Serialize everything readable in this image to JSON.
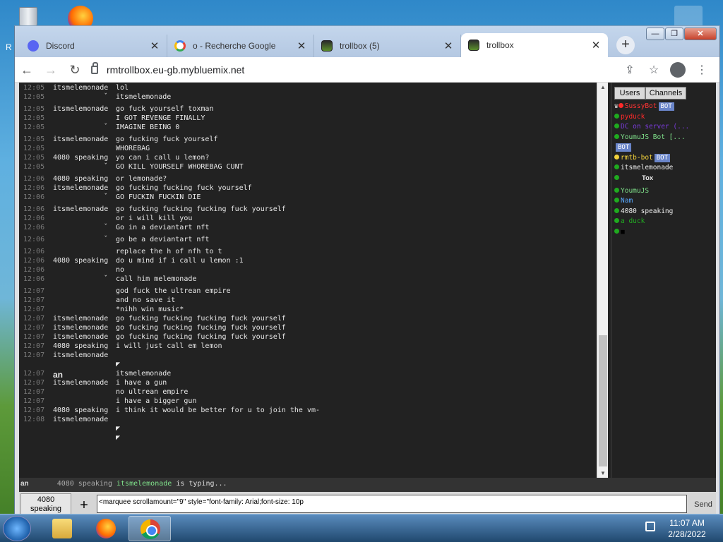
{
  "desktop": {
    "left_label": "R"
  },
  "browser": {
    "tabs": [
      {
        "title": "Discord",
        "favicon": "discord-icon"
      },
      {
        "title": "o - Recherche Google",
        "favicon": "google-icon"
      },
      {
        "title": "trollbox (5)",
        "favicon": "trollbox-icon"
      },
      {
        "title": "trollbox",
        "favicon": "trollbox-icon",
        "active": true
      }
    ],
    "url": "rmtrollbox.eu-gb.mybluemix.net"
  },
  "chat": {
    "messages": [
      {
        "time": "12:05",
        "nick": "itsmelemonade",
        "text": "lol"
      },
      {
        "time": "12:05",
        "nick": "",
        "text": "itsmelemonade",
        "quote": true
      },
      {
        "time": "12:05",
        "nick": "itsmelemonade",
        "text": "go fuck yourself toxman"
      },
      {
        "time": "12:05",
        "nick": "",
        "text": "I GOT REVENGE FINALLY"
      },
      {
        "time": "12:05",
        "nick": "",
        "text": "IMAGINE BEING 0",
        "quote": true
      },
      {
        "time": "12:05",
        "nick": "itsmelemonade",
        "text": "go fucking fuck yourself"
      },
      {
        "time": "12:05",
        "nick": "",
        "text": "WHOREBAG"
      },
      {
        "time": "12:05",
        "nick": "4080 speaking",
        "text": "yo can i call u lemon?"
      },
      {
        "time": "12:05",
        "nick": "",
        "text": "GO KILL YOURSELF WHOREBAG CUNT",
        "quote": true
      },
      {
        "time": "12:06",
        "nick": "4080 speaking",
        "text": "or lemonade?"
      },
      {
        "time": "12:06",
        "nick": "itsmelemonade",
        "text": "go fucking fucking fuck yourself"
      },
      {
        "time": "12:06",
        "nick": "",
        "text": "GO FUCKIN FUCKIN DIE",
        "quote": true
      },
      {
        "time": "12:06",
        "nick": "itsmelemonade",
        "text": "go fucking fucking fucking fuck yourself"
      },
      {
        "time": "12:06",
        "nick": "",
        "text": "or i will kill you"
      },
      {
        "time": "12:06",
        "nick": "",
        "text": "Go in a deviantart nft",
        "quote": true
      },
      {
        "time": "12:06",
        "nick": "",
        "text": "go be a deviantart nft",
        "quote": true
      },
      {
        "time": "12:06",
        "nick": "",
        "text": "replace the h of nfh to t"
      },
      {
        "time": "12:06",
        "nick": "4080 speaking",
        "text": "do u mind if i call u lemon :1"
      },
      {
        "time": "12:06",
        "nick": "",
        "text": "no"
      },
      {
        "time": "12:06",
        "nick": "",
        "text": "call him melemonade",
        "quote": true
      },
      {
        "time": "12:07",
        "nick": "",
        "text": "god fuck the ultrean empire"
      },
      {
        "time": "12:07",
        "nick": "",
        "text": "and no save it"
      },
      {
        "time": "12:07",
        "nick": "",
        "text": "*nihh win music*"
      },
      {
        "time": "12:07",
        "nick": "itsmelemonade",
        "text": "go fucking fucking fucking fuck yourself"
      },
      {
        "time": "12:07",
        "nick": "itsmelemonade",
        "text": "go fucking fucking fucking fuck yourself"
      },
      {
        "time": "12:07",
        "nick": "itsmelemonade",
        "text": "go fucking fucking fucking fuck yourself"
      },
      {
        "time": "12:07",
        "nick": "4080 speaking",
        "text": "i will just call em lemon"
      },
      {
        "time": "12:07",
        "nick": "itsmelemonade",
        "text": ""
      },
      {
        "time": "",
        "nick": "",
        "text": "◤"
      },
      {
        "time": "12:07",
        "nick": "an",
        "text": "itsmelemonade",
        "bignick": true
      },
      {
        "time": "12:07",
        "nick": "itsmelemonade",
        "text": "i have a gun"
      },
      {
        "time": "12:07",
        "nick": "",
        "text": "no ultrean empire"
      },
      {
        "time": "12:07",
        "nick": "",
        "text": "i have a bigger gun"
      },
      {
        "time": "12:07",
        "nick": "4080 speaking",
        "text": "i think it would be better for u to join the vm-"
      },
      {
        "time": "12:08",
        "nick": "itsmelemonade",
        "text": ""
      },
      {
        "time": "",
        "nick": "",
        "text": "◤"
      },
      {
        "time": "",
        "nick": "",
        "text": "◤"
      }
    ]
  },
  "users_panel": {
    "users_button": "Users",
    "channels_button": "Channels",
    "users": [
      {
        "name": "SussyBot",
        "color": "#ff3333",
        "status": "red",
        "bot": true,
        "icon": true
      },
      {
        "name": "pyduck",
        "color": "#ff2a2a",
        "status": "green"
      },
      {
        "name": "DC on server (...",
        "color": "#7b3bdc",
        "status": "green"
      },
      {
        "name": "YoumuJS Bot [...",
        "color": "#7fe08a",
        "status": "green"
      },
      {
        "name": "",
        "color": "#eee",
        "status": "",
        "bot": true
      },
      {
        "name": "rmtb-bot",
        "color": "#f2d23b",
        "status": "yellow",
        "bot": true
      },
      {
        "name": "itsmelemonade",
        "color": "#eeeeee",
        "status": "green"
      },
      {
        "name": "Tox",
        "color": "#eeeeee",
        "status": "green",
        "bold": true
      },
      {
        "name": "YoumuJS",
        "color": "#7fe08a",
        "status": "green"
      },
      {
        "name": "Nam",
        "color": "#5aa9ff",
        "status": "green"
      },
      {
        "name": "4080 speaking",
        "color": "#eeeeee",
        "status": "green"
      },
      {
        "name": "a duck",
        "color": "#22aa22",
        "status": "green"
      },
      {
        "name": "■",
        "color": "#000000",
        "status": "green"
      }
    ],
    "bot_label": "BOT"
  },
  "typing": {
    "nick_left": "an",
    "text1": "4080 speaking",
    "text2": "itsmelemonade",
    "text3": "is typing..."
  },
  "input": {
    "nick_button": "4080 speaking",
    "plus": "+",
    "value": "<marquee scrollamount=\"9\" style=\"font-family: Arial;font-size: 10p",
    "send": "Send"
  },
  "taskbar": {
    "time": "11:07 AM",
    "date": "2/28/2022"
  }
}
